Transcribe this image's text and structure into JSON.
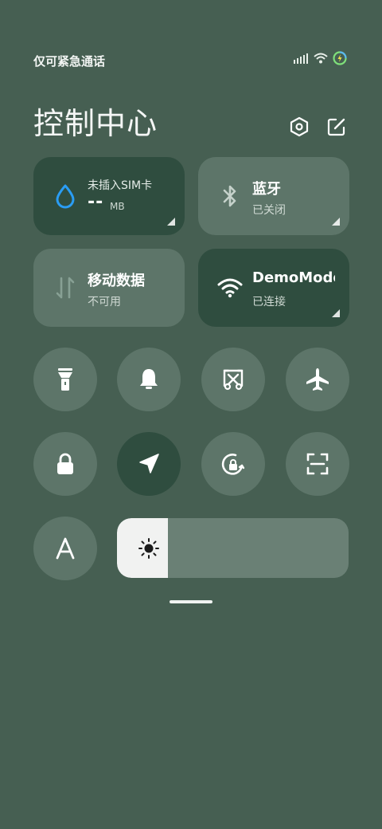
{
  "status_bar": {
    "carrier_text": "仅可紧急通话"
  },
  "header": {
    "title": "控制中心"
  },
  "tiles": {
    "data_usage": {
      "line1": "未插入SIM卡",
      "value": "--",
      "unit": "MB"
    },
    "bluetooth": {
      "label": "蓝牙",
      "status": "已关闭"
    },
    "mobile_data": {
      "label": "移动数据",
      "status": "不可用"
    },
    "wifi": {
      "label": "DemoMode",
      "status": "已连接"
    }
  },
  "brightness": {
    "level": 0.22
  },
  "colors": {
    "background": "#465f52",
    "tile_active": "#2f4d3f",
    "tile_inactive": "#5d7569",
    "accent_blue": "#2a9df4"
  }
}
